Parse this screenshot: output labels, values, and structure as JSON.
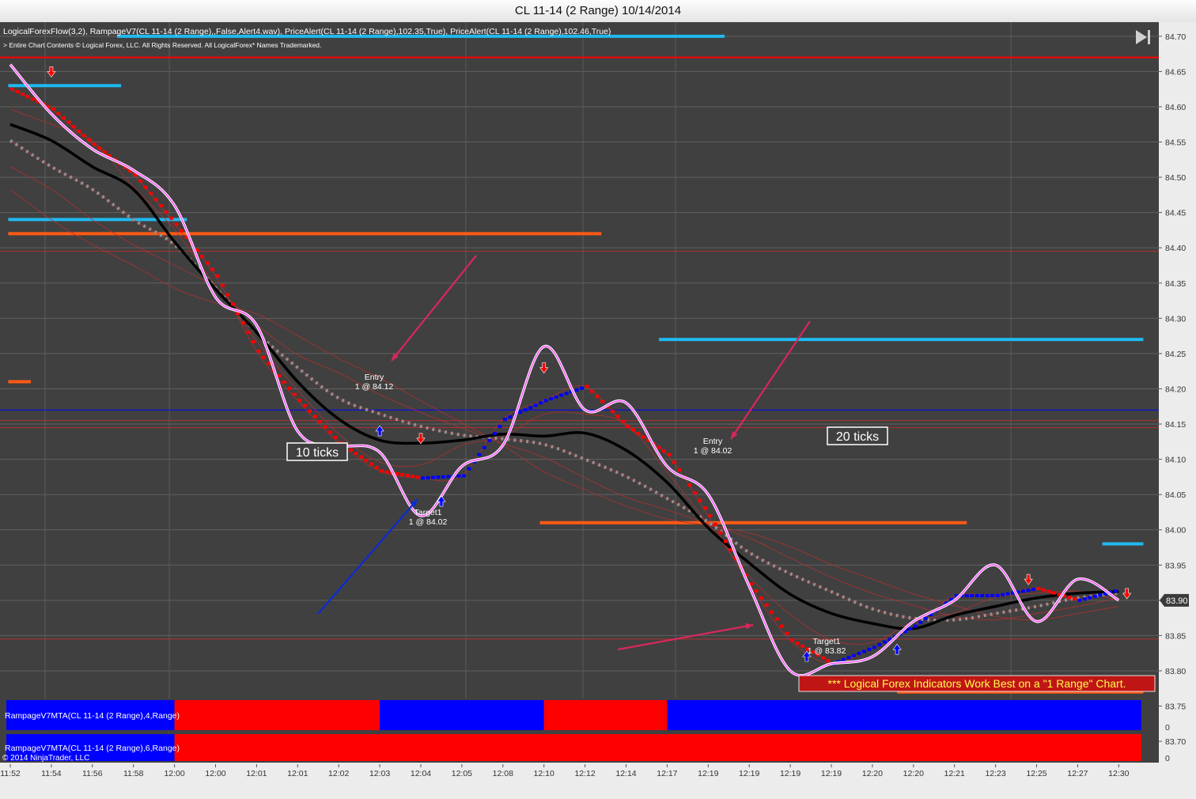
{
  "window": {
    "title": "CL 11-14 (2 Range)  10/14/2014"
  },
  "header": {
    "indicators": "LogicalForexFlow(3,2),  RampageV7(CL 11-14 (2 Range),,False,Alert4.wav), PriceAlert(CL 11-14 (2 Range),102.35,True), PriceAlert(CL 11-14 (2 Range),102.46,True)",
    "copyright": " > Entire Chart Contents © Logical Forex, LLC. All Rights Reserved. All LogicalForex* Names Trademarked."
  },
  "colors": {
    "background": "#404040",
    "price_line": "#ff55ff",
    "sell": "#ff0000",
    "buy": "#0000ff",
    "ma": "#000000",
    "ribbon": "#b13030",
    "dotted_ma": "#909090",
    "level_cyan": "#1fb9ef",
    "level_orange": "#ff5a14"
  },
  "chart_data": {
    "type": "line",
    "instrument": "CL 11-14 (2 Range)",
    "x": [
      "11:52",
      "11:54",
      "11:56",
      "11:58",
      "12:00",
      "12:00",
      "12:01",
      "12:01",
      "12:02",
      "12:03",
      "12:04",
      "12:05",
      "12:08",
      "12:10",
      "12:12",
      "12:14",
      "12:17",
      "12:19",
      "12:19",
      "12:19",
      "12:19",
      "12:20",
      "12:20",
      "12:21",
      "12:23",
      "12:25",
      "12:27",
      "12:30"
    ],
    "series": [
      {
        "values": [
          84.66,
          84.59,
          84.54,
          84.51,
          84.46,
          84.33,
          84.29,
          84.14,
          84.12,
          84.11,
          84.02,
          84.09,
          84.12,
          84.26,
          84.17,
          84.18,
          84.09,
          84.05,
          83.92,
          83.8,
          83.81,
          83.82,
          83.87,
          83.9,
          83.95,
          83.87,
          83.93,
          83.9
        ]
      }
    ],
    "ylim": [
      83.69,
      84.72
    ],
    "y_ticks": [
      "84.70",
      "84.65",
      "84.60",
      "84.55",
      "84.50",
      "84.45",
      "84.40",
      "84.35",
      "84.30",
      "84.25",
      "84.20",
      "84.15",
      "84.10",
      "84.05",
      "84.00",
      "83.95",
      "83.90",
      "83.85",
      "83.80",
      "83.75",
      "83.70"
    ],
    "last_price": "83.90",
    "annotations": [
      {
        "text": "10 ticks"
      },
      {
        "text": "20 ticks"
      },
      {
        "text": "Entry",
        "sub": "1 @ 84.12"
      },
      {
        "text": "Entry",
        "sub": "1 @ 84.02"
      },
      {
        "text": "Target1",
        "sub": "1 @ 84.02"
      },
      {
        "text": "Target1",
        "sub": "1 @ 83.82"
      }
    ],
    "banner": "*** Logical Forex Indicators Work Best on a \"1 Range\" Chart.",
    "panels": [
      {
        "label": "RampageV7MTA(CL 11-14 (2 Range),4,Range)",
        "zero": "0",
        "segments": [
          [
            "12:00",
            "blue"
          ],
          [
            "12:03",
            "red"
          ],
          [
            "12:10",
            "blue"
          ],
          [
            "12:17",
            "red"
          ],
          [
            "12:20",
            "blue"
          ],
          [
            "12:30",
            "blue"
          ]
        ]
      },
      {
        "label": "RampageV7MTA(CL 11-14 (2 Range),6,Range)",
        "zero": "0",
        "segments": [
          [
            "12:00",
            "blue"
          ],
          [
            "12:30",
            "red"
          ]
        ]
      }
    ],
    "footer": "© 2014 NinjaTrader, LLC"
  }
}
